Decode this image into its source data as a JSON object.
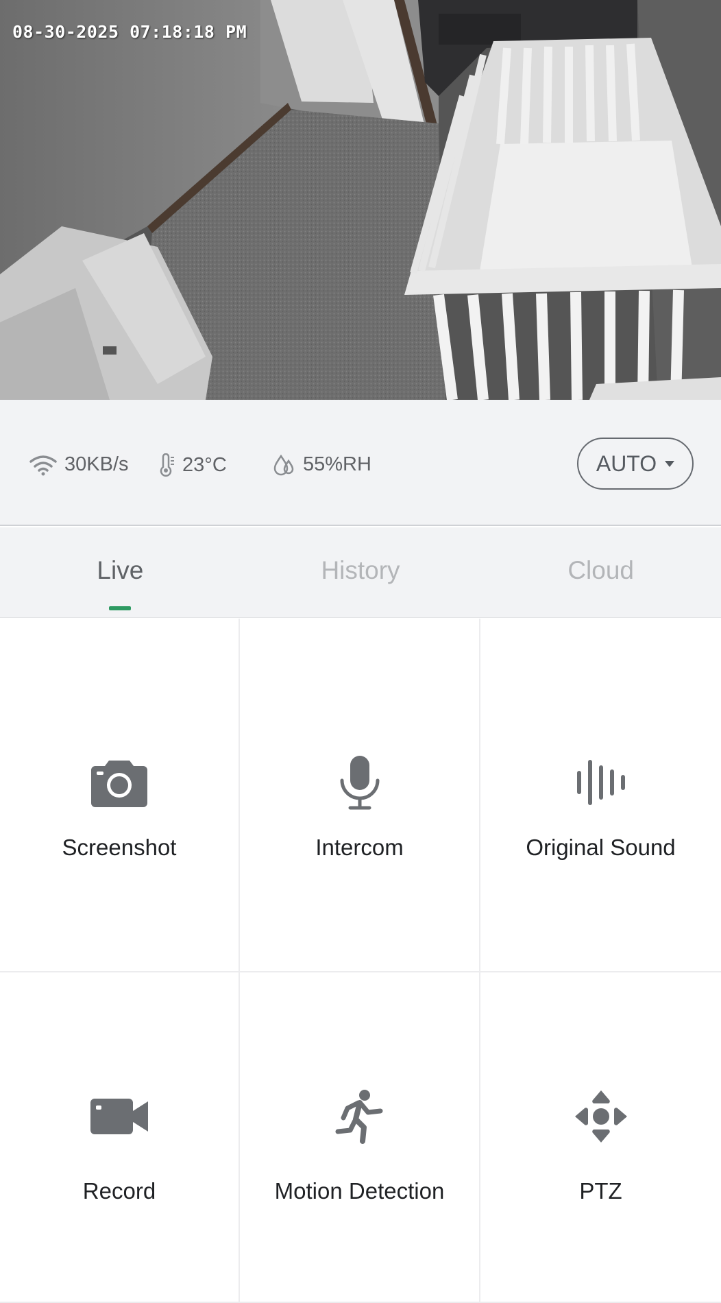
{
  "camera": {
    "timestamp": "08-30-2025 07:18:18 PM"
  },
  "status": {
    "speed": "30KB/s",
    "temperature": "23°C",
    "humidity": "55%RH",
    "mode_label": "AUTO",
    "icons": [
      "wifi-icon",
      "thermometer-icon",
      "humidity-icon",
      "caret-down-icon"
    ]
  },
  "tabs": [
    {
      "label": "Live",
      "active": true
    },
    {
      "label": "History",
      "active": false
    },
    {
      "label": "Cloud",
      "active": false
    }
  ],
  "actions": [
    {
      "label": "Screenshot",
      "icon": "camera-icon"
    },
    {
      "label": "Intercom",
      "icon": "microphone-icon"
    },
    {
      "label": "Original Sound",
      "icon": "sound-wave-icon"
    },
    {
      "label": "Record",
      "icon": "video-camera-icon"
    },
    {
      "label": "Motion Detection",
      "icon": "running-person-icon"
    },
    {
      "label": "PTZ",
      "icon": "ptz-arrows-icon"
    }
  ],
  "colors": {
    "accent": "#2e9a62",
    "icon": "#6b6e72",
    "panel_bg": "#f2f3f5"
  }
}
